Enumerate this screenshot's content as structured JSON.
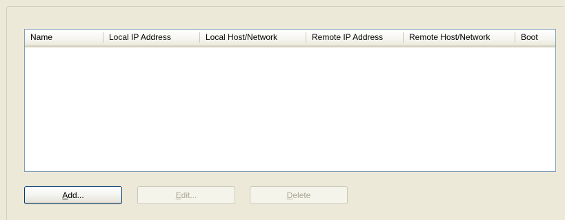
{
  "listview": {
    "columns": [
      "Name",
      "Local IP Address",
      "Local Host/Network",
      "Remote IP Address",
      "Remote Host/Network",
      "Boot"
    ],
    "rows": []
  },
  "buttons": {
    "add": {
      "mnemonic": "A",
      "rest": "dd...",
      "enabled": true
    },
    "edit": {
      "mnemonic": "E",
      "rest": "dit...",
      "enabled": false
    },
    "delete": {
      "mnemonic": "D",
      "rest": "elete",
      "enabled": false
    }
  },
  "colors": {
    "window_bg": "#ece9d8",
    "list_border": "#7f9db9",
    "button_border": "#003c74",
    "disabled_text": "#aca899"
  }
}
